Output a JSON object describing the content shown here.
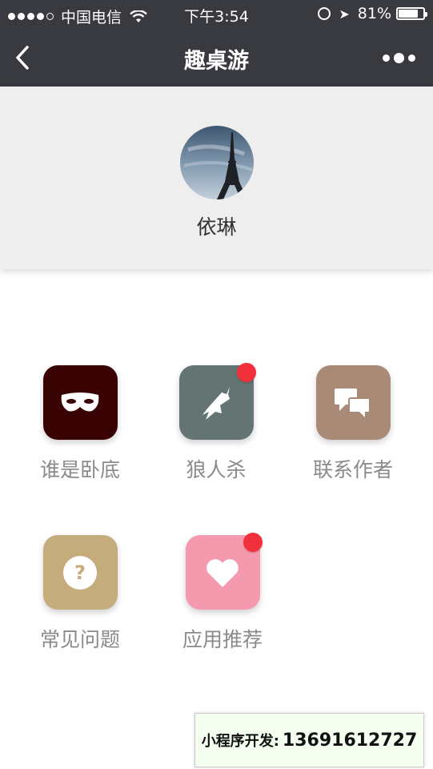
{
  "status_bar": {
    "carrier": "中国电信",
    "time": "下午3:54",
    "battery": "81%",
    "battery_level": 0.81
  },
  "nav": {
    "title": "趣桌游",
    "back_icon": "chevron-left-icon",
    "more_icon": "more-dots-icon"
  },
  "profile": {
    "name": "依琳",
    "avatar_subject": "eiffel-tower"
  },
  "menu": [
    {
      "label": "谁是卧底",
      "icon": "mask-icon",
      "color": "#3a0303",
      "badge": false
    },
    {
      "label": "狼人杀",
      "icon": "wolf-icon",
      "color": "#647473",
      "badge": true
    },
    {
      "label": "联系作者",
      "icon": "chat-bubbles-icon",
      "color": "#a88a77",
      "badge": false
    },
    {
      "label": "常见问题",
      "icon": "question-icon",
      "color": "#c5ac7d",
      "badge": false
    },
    {
      "label": "应用推荐",
      "icon": "heart-icon",
      "color": "#f599ae",
      "badge": true
    }
  ],
  "badge_color": "#f2303b",
  "footer_ad": {
    "label": "小程序开发:",
    "phone": "13691612727"
  }
}
